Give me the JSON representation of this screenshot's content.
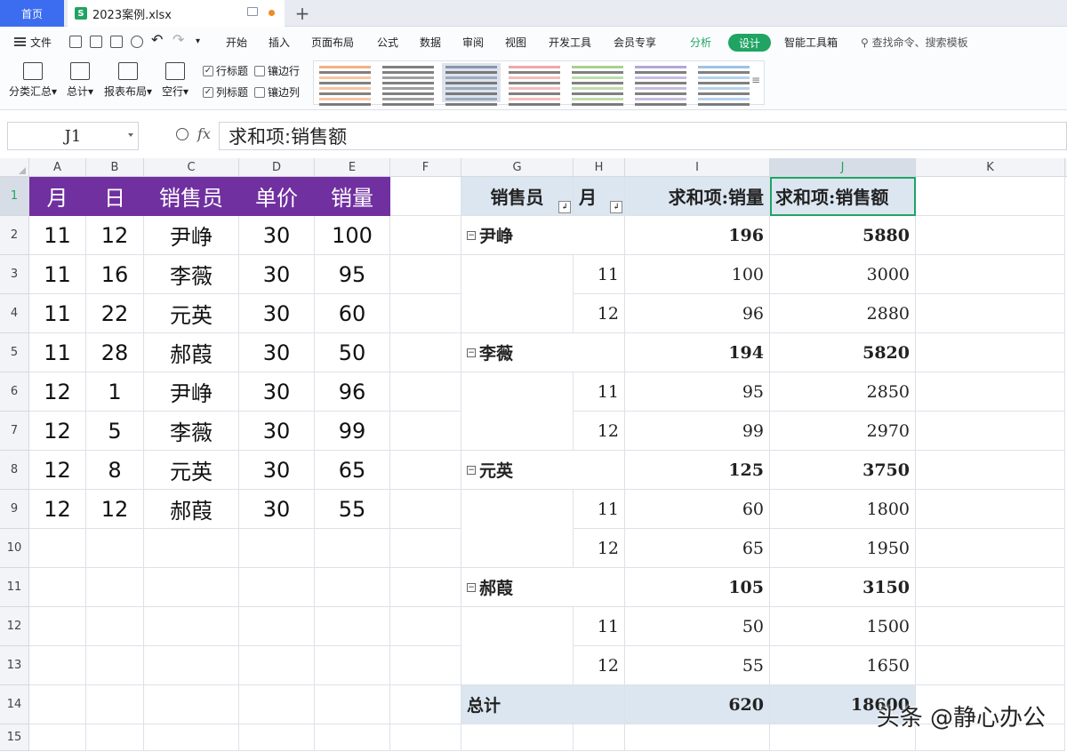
{
  "tabs": {
    "home": "首页",
    "file": "2023案例.xlsx",
    "file_badge": "S",
    "add": "+"
  },
  "menu": {
    "file": "文件",
    "items": [
      "开始",
      "插入",
      "页面布局",
      "公式",
      "数据",
      "审阅",
      "视图",
      "开发工具",
      "会员专享"
    ],
    "analyze": "分析",
    "design": "设计",
    "smart_tools": "智能工具箱",
    "search": "查找命令、搜索模板"
  },
  "ribbon": {
    "subtotal": "分类汇总",
    "grand_total": "总计",
    "report_layout": "报表布局",
    "blank_rows": "空行",
    "row_headers": "行标题",
    "col_headers": "列标题",
    "banded_rows": "镶边行",
    "banded_cols": "镶边列",
    "row_headers_checked": true,
    "col_headers_checked": true,
    "style_colors": [
      "#f4b183",
      "#7f7f7f",
      "#8497b0",
      "#f4a6a6",
      "#a9d18e",
      "#b4a7d6",
      "#9dc3e6"
    ]
  },
  "formula_bar": {
    "name_box": "J1",
    "fx": "fx",
    "content": "求和项:销售额"
  },
  "columns": [
    "A",
    "B",
    "C",
    "D",
    "E",
    "F",
    "G",
    "H",
    "I",
    "J",
    "K"
  ],
  "rows": [
    "1",
    "2",
    "3",
    "4",
    "5",
    "6",
    "7",
    "8",
    "9",
    "10",
    "11",
    "12",
    "13",
    "14",
    "15"
  ],
  "source_table": {
    "headers": [
      "月",
      "日",
      "销售员",
      "单价",
      "销量"
    ],
    "rows": [
      [
        "11",
        "12",
        "尹峥",
        "30",
        "100"
      ],
      [
        "11",
        "16",
        "李薇",
        "30",
        "95"
      ],
      [
        "11",
        "22",
        "元英",
        "30",
        "60"
      ],
      [
        "11",
        "28",
        "郝葭",
        "30",
        "50"
      ],
      [
        "12",
        "1",
        "尹峥",
        "30",
        "96"
      ],
      [
        "12",
        "5",
        "李薇",
        "30",
        "99"
      ],
      [
        "12",
        "8",
        "元英",
        "30",
        "65"
      ],
      [
        "12",
        "12",
        "郝葭",
        "30",
        "55"
      ]
    ]
  },
  "pivot": {
    "headers": {
      "salesperson": "销售员",
      "month": "月",
      "sum_qty": "求和项:销量",
      "sum_amount": "求和项:销售额"
    },
    "groups": [
      {
        "name": "尹峥",
        "qty": "196",
        "amount": "5880",
        "rows": [
          {
            "month": "11",
            "qty": "100",
            "amount": "3000"
          },
          {
            "month": "12",
            "qty": "96",
            "amount": "2880"
          }
        ]
      },
      {
        "name": "李薇",
        "qty": "194",
        "amount": "5820",
        "rows": [
          {
            "month": "11",
            "qty": "95",
            "amount": "2850"
          },
          {
            "month": "12",
            "qty": "99",
            "amount": "2970"
          }
        ]
      },
      {
        "name": "元英",
        "qty": "125",
        "amount": "3750",
        "rows": [
          {
            "month": "11",
            "qty": "60",
            "amount": "1800"
          },
          {
            "month": "12",
            "qty": "65",
            "amount": "1950"
          }
        ]
      },
      {
        "name": "郝葭",
        "qty": "105",
        "amount": "3150",
        "rows": [
          {
            "month": "11",
            "qty": "50",
            "amount": "1500"
          },
          {
            "month": "12",
            "qty": "55",
            "amount": "1650"
          }
        ]
      }
    ],
    "total_label": "总计",
    "total_qty": "620",
    "total_amount": "18600"
  },
  "watermark": "头条 @静心办公"
}
